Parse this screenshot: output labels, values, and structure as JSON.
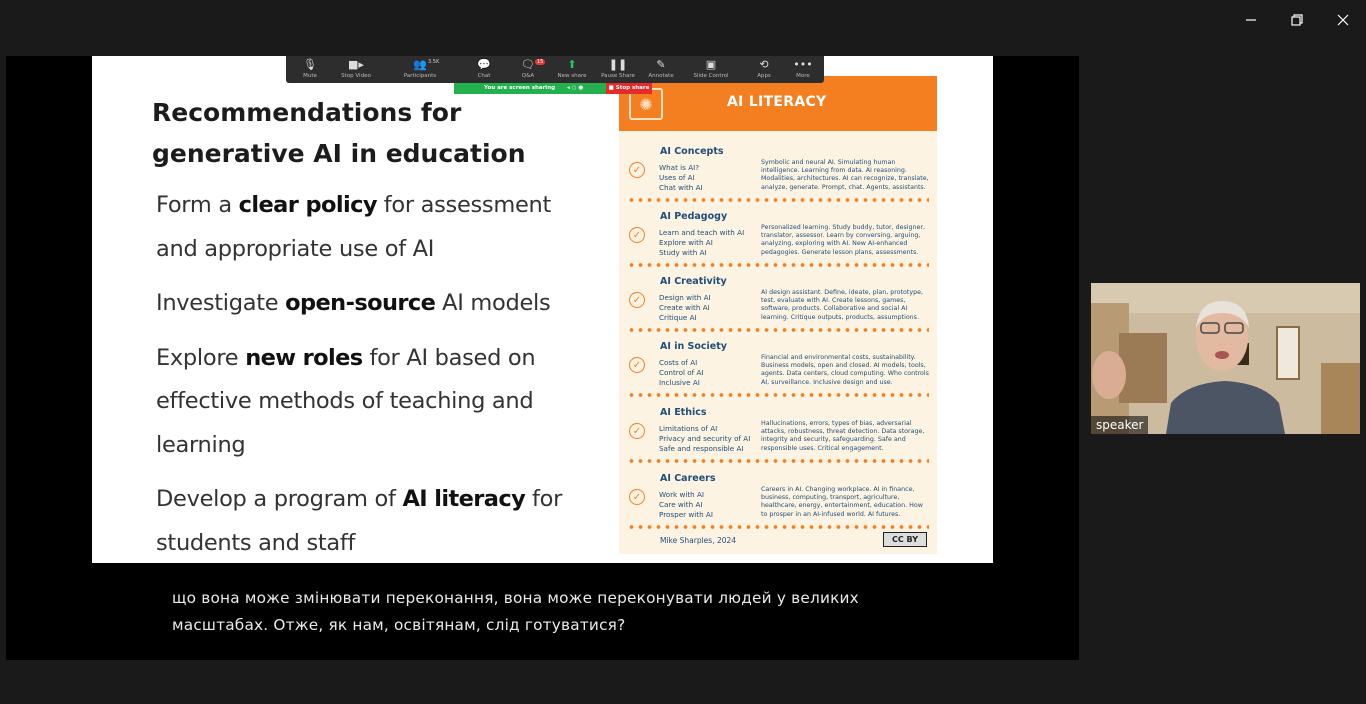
{
  "window_controls": {
    "minimize": "minimize",
    "restore": "restore",
    "close": "close"
  },
  "zoom_toolbar": {
    "buttons": [
      {
        "label": "Mute",
        "icon": "microphone-icon"
      },
      {
        "label": "Stop Video",
        "icon": "video-camera-icon"
      },
      {
        "label": "Participants",
        "icon": "participants-icon",
        "count": "3.5K"
      },
      {
        "label": "Chat",
        "icon": "chat-icon"
      },
      {
        "label": "Q&A",
        "icon": "qa-icon",
        "badge": "15"
      },
      {
        "label": "New share",
        "icon": "new-share-icon"
      },
      {
        "label": "Pause Share",
        "icon": "pause-icon"
      },
      {
        "label": "Annotate",
        "icon": "annotate-icon"
      },
      {
        "label": "Slide Control",
        "icon": "slide-control-icon"
      },
      {
        "label": "Apps",
        "icon": "apps-icon"
      },
      {
        "label": "More",
        "icon": "more-icon"
      }
    ],
    "sharing_status": "You are screen sharing",
    "stop_share": "Stop share"
  },
  "slide": {
    "title_line1": "Recommendations for",
    "title_line2": "generative AI in education",
    "bullets": [
      {
        "pre": "Form a ",
        "bold": "clear policy",
        "post": " for assessment and appropriate use of AI"
      },
      {
        "pre": "Investigate ",
        "bold": "open-source",
        "post": " AI models"
      },
      {
        "pre": "Explore ",
        "bold": "new roles",
        "post": " for AI based on effective methods of teaching and learning"
      },
      {
        "pre": "Develop a program of ",
        "bold": "AI literacy",
        "post": " for students and staff"
      }
    ]
  },
  "poster": {
    "title": "AI LITERACY",
    "sections": [
      {
        "title": "AI Concepts",
        "items": [
          "What is AI?",
          "Uses of AI",
          "Chat with AI"
        ],
        "description": "Symbolic and neural AI. Simulating human intelligence. Learning from data. AI reasoning. Modalities, architectures. AI can recognize, translate, analyze, generate. Prompt, chat. Agents, assistants."
      },
      {
        "title": "AI Pedagogy",
        "items": [
          "Learn and teach with AI",
          "Explore with AI",
          "Study with AI"
        ],
        "description": "Personalized learning. Study buddy, tutor, designer, translator, assessor. Learn by conversing, arguing, analyzing, exploring with AI. New AI-enhanced pedagogies. Generate lesson plans, assessments."
      },
      {
        "title": "AI Creativity",
        "items": [
          "Design with AI",
          "Create with AI",
          "Critique AI"
        ],
        "description": "AI design assistant. Define, ideate, plan, prototype, test, evaluate with AI. Create lessons, games, software, products. Collaborative and social AI learning. Critique outputs, products, assumptions."
      },
      {
        "title": "AI in Society",
        "items": [
          "Costs of AI",
          "Control of AI",
          "Inclusive AI"
        ],
        "description": "Financial and environmental costs, sustainability. Business models, open and closed. AI models, tools, agents. Data centers, cloud computing. Who controls AI, surveillance. Inclusive design and use."
      },
      {
        "title": "AI Ethics",
        "items": [
          "Limitations of AI",
          "Privacy and security of AI",
          "Safe and responsible AI"
        ],
        "description": "Hallucinations, errors, types of bias, adversarial attacks, robustness, threat detection. Data storage, integrity and security, safeguarding. Safe and responsible uses. Critical engagement."
      },
      {
        "title": "AI Careers",
        "items": [
          "Work with AI",
          "Care with AI",
          "Prosper with AI"
        ],
        "description": "Careers in AI. Changing workplace. AI in finance, business, computing, transport, agriculture, healthcare, energy, entertainment, education. How to prosper in an AI-infused world. AI futures."
      }
    ],
    "author": "Mike Sharples, 2024",
    "license": "CC BY"
  },
  "captions": {
    "line1": "що вона може змінювати переконання, вона може переконувати людей у великих",
    "line2": "масштабах. Отже, як нам, освітянам, слід готуватися?"
  },
  "video_tile": {
    "name": "speaker"
  },
  "colors": {
    "accent": "#f47f20",
    "poster_text": "#1f4e79",
    "share_green": "#22b14c",
    "stop_red": "#e32b2b"
  }
}
